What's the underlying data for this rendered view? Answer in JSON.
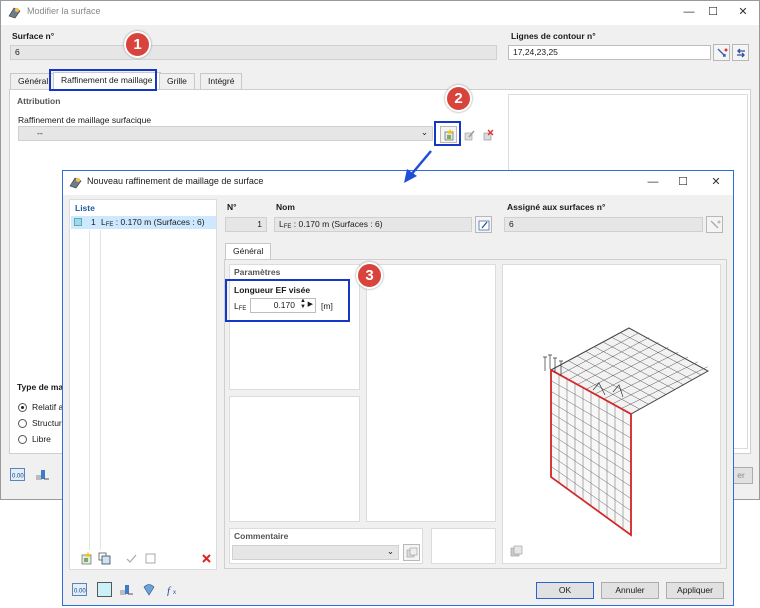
{
  "main": {
    "title": "Modifier la surface",
    "surface_no_label": "Surface n°",
    "surface_no_value": "6",
    "contour_label": "Lignes de contour n°",
    "contour_value": "17,24,23,25",
    "tabs": [
      "Général",
      "Raffinement de maillage",
      "Grille",
      "Intégré"
    ],
    "attribution_label": "Attribution",
    "mesh_refinement_label": "Raffinement de maillage surfacique",
    "mesh_refinement_value": "--",
    "type_label": "Type de mai",
    "radio_options": [
      "Relatif au",
      "Structure",
      "Libre"
    ],
    "ok_partial": "er"
  },
  "dialog": {
    "title": "Nouveau raffinement de maillage de surface",
    "list_label": "Liste",
    "list_item_no": "1",
    "list_item_prefix": "L",
    "list_item_sub": "FE",
    "list_item_rest": " : 0.170 m (Surfaces : 6)",
    "no_label": "N°",
    "no_value": "1",
    "name_label": "Nom",
    "name_prefix": "L",
    "name_sub": "FE",
    "name_rest": " : 0.170 m (Surfaces : 6)",
    "assigned_label": "Assigné aux surfaces n°",
    "assigned_value": "6",
    "tab_general": "Général",
    "params_label": "Paramètres",
    "target_fe_label": "Longueur EF visée",
    "lfe_prefix": "L",
    "lfe_sub": "FE",
    "lfe_value": "0.170",
    "lfe_unit": "[m]",
    "comment_label": "Commentaire",
    "ok": "OK",
    "cancel": "Annuler",
    "apply": "Appliquer"
  },
  "badges": [
    "1",
    "2",
    "3"
  ],
  "icons": {
    "app": "app-icon",
    "minimize": "minimize-icon",
    "maximize": "maximize-icon",
    "close": "close-icon",
    "new": "new-item-icon",
    "edit": "edit-icon",
    "delete": "delete-icon",
    "arrow": "blue-arrow-icon"
  },
  "colors": {
    "accent_blue": "#1437c8",
    "badge_red": "#d8433b",
    "selection": "#cde8ff",
    "mesh_red": "#d22a2a"
  }
}
